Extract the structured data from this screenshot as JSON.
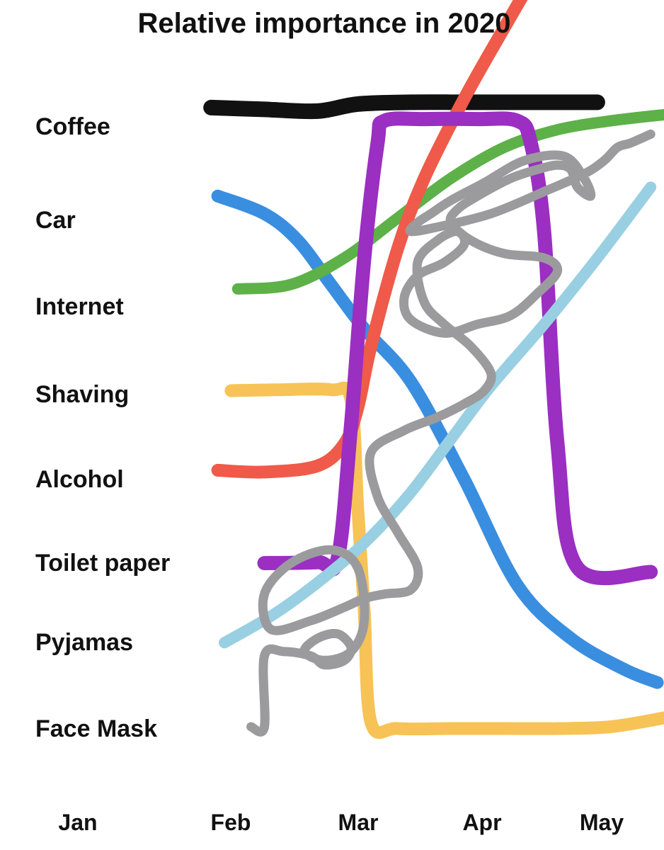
{
  "chart_data": {
    "type": "line",
    "title": "Relative importance in 2020",
    "categories": [
      "Coffee",
      "Car",
      "Internet",
      "Shaving",
      "Alcohol",
      "Toilet paper",
      "Pyjamas",
      "Face Mask"
    ],
    "x_ticks": [
      "Jan",
      "Feb",
      "Mar",
      "Apr",
      "May"
    ],
    "xlim": [
      1,
      5.4
    ],
    "ylim": [
      0,
      7.8
    ],
    "grid": false,
    "legend": "none",
    "series": [
      {
        "color": "#111111",
        "stroke": 22,
        "x": [
          2.0,
          2.4,
          2.8,
          3.1,
          3.5,
          3.9,
          4.3,
          4.7,
          4.9
        ],
        "y": [
          7.0,
          6.98,
          6.96,
          7.04,
          7.06,
          7.06,
          7.06,
          7.06,
          7.06
        ]
      },
      {
        "color": "#3a8ee0",
        "stroke": 18,
        "x": [
          2.05,
          2.4,
          2.65,
          2.9,
          3.15,
          3.5,
          3.9,
          4.3,
          4.7,
          5.1,
          5.35
        ],
        "y": [
          6.0,
          5.8,
          5.5,
          5.0,
          4.5,
          3.9,
          2.8,
          1.6,
          1.0,
          0.65,
          0.5
        ]
      },
      {
        "color": "#5db148",
        "stroke": 16,
        "x": [
          2.2,
          2.6,
          3.0,
          3.4,
          3.8,
          4.2,
          4.6,
          5.0,
          5.4
        ],
        "y": [
          4.95,
          5.0,
          5.3,
          5.75,
          6.2,
          6.55,
          6.75,
          6.85,
          6.92
        ]
      },
      {
        "color": "#f7c356",
        "stroke": 18,
        "x": [
          2.15,
          2.5,
          2.9,
          3.05,
          3.1,
          3.15,
          3.2,
          3.4,
          3.8,
          4.2,
          4.6,
          5.0,
          5.4
        ],
        "y": [
          3.8,
          3.81,
          3.81,
          3.7,
          2.5,
          1.3,
          0.05,
          -0.02,
          -0.02,
          -0.02,
          -0.02,
          0.0,
          0.1
        ]
      },
      {
        "color": "#ef5a4a",
        "stroke": 18,
        "x": [
          2.05,
          2.4,
          2.8,
          3.0,
          3.1,
          3.2,
          3.4,
          3.6,
          3.9,
          4.2,
          4.45
        ],
        "y": [
          2.9,
          2.88,
          2.95,
          3.2,
          3.6,
          4.3,
          5.4,
          6.2,
          7.1,
          7.9,
          8.55
        ]
      },
      {
        "color": "#9a2fc2",
        "stroke": 20,
        "x": [
          2.4,
          2.8,
          2.95,
          3.05,
          3.15,
          3.25,
          3.3,
          3.6,
          4.0,
          4.3,
          4.4,
          4.5,
          4.6,
          4.75,
          5.3
        ],
        "y": [
          1.85,
          1.86,
          1.9,
          3.4,
          5.3,
          6.6,
          6.85,
          6.87,
          6.87,
          6.85,
          6.6,
          5.6,
          3.2,
          1.8,
          1.75
        ]
      },
      {
        "color": "#99cfe2",
        "stroke": 16,
        "x": [
          2.1,
          2.5,
          2.9,
          3.2,
          3.5,
          3.8,
          4.1,
          4.5,
          4.9,
          5.3
        ],
        "y": [
          0.95,
          1.3,
          1.75,
          2.15,
          2.65,
          3.25,
          3.85,
          4.55,
          5.3,
          6.1
        ]
      },
      {
        "color": "#9b9b9d",
        "stroke": 13,
        "x": [
          2.3,
          2.4,
          2.4,
          2.55,
          2.75,
          2.85,
          3.0,
          3.05,
          2.95,
          2.8,
          2.7,
          2.85,
          3.05,
          3.15,
          3.1,
          2.9,
          2.6,
          2.4,
          2.45,
          2.75,
          3.0,
          3.15,
          3.3,
          3.5,
          3.55,
          3.4,
          3.25,
          3.2,
          3.45,
          3.7,
          3.9,
          4.05,
          4.1,
          3.95,
          3.75,
          3.6,
          3.55,
          3.7,
          3.85,
          3.9,
          3.75,
          3.55,
          3.45,
          3.5,
          3.75,
          4.0,
          4.25,
          4.45,
          4.6,
          4.5,
          4.2,
          3.95,
          3.8,
          3.85,
          4.0,
          4.25,
          4.45,
          4.6,
          4.7,
          4.75,
          4.85,
          4.8,
          4.65,
          4.35,
          4.05,
          3.8,
          3.65,
          3.55,
          3.5,
          3.7,
          4.1,
          4.5,
          4.8,
          4.95,
          5.05,
          5.15,
          5.3
        ],
        "y": [
          0.0,
          0.0,
          0.8,
          0.85,
          0.8,
          0.7,
          0.75,
          0.9,
          1.05,
          1.0,
          0.85,
          0.75,
          0.85,
          1.2,
          1.8,
          2.0,
          1.85,
          1.5,
          1.1,
          1.2,
          1.35,
          1.45,
          1.5,
          1.55,
          1.8,
          2.2,
          2.6,
          3.1,
          3.35,
          3.5,
          3.65,
          3.8,
          4.0,
          4.3,
          4.55,
          4.8,
          5.25,
          5.5,
          5.6,
          5.45,
          5.25,
          5.1,
          4.85,
          4.6,
          4.45,
          4.55,
          4.65,
          4.9,
          5.15,
          5.3,
          5.35,
          5.5,
          5.7,
          5.85,
          6.0,
          6.2,
          6.3,
          6.35,
          6.3,
          6.1,
          6.0,
          6.2,
          6.45,
          6.4,
          6.15,
          5.95,
          5.8,
          5.7,
          5.6,
          5.65,
          5.8,
          6.05,
          6.25,
          6.4,
          6.55,
          6.6,
          6.7
        ]
      }
    ]
  }
}
